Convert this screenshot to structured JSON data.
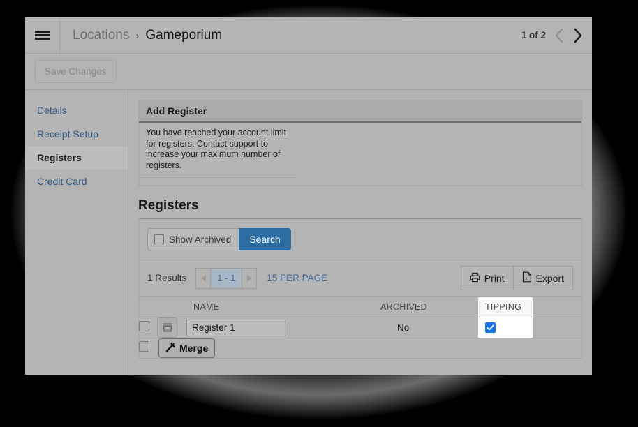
{
  "header": {
    "menu_icon": "hamburger-icon",
    "breadcrumb_parent": "Locations",
    "breadcrumb_separator": "›",
    "breadcrumb_current": "Gameporium",
    "pager_label": "1 of 2",
    "prev_icon": "chevron-left-icon",
    "next_icon": "chevron-right-icon"
  },
  "toolbar": {
    "save_label": "Save Changes"
  },
  "sidebar": {
    "items": [
      {
        "label": "Details",
        "active": false
      },
      {
        "label": "Receipt Setup",
        "active": false
      },
      {
        "label": "Registers",
        "active": true
      },
      {
        "label": "Credit Card",
        "active": false
      }
    ]
  },
  "add_register": {
    "title": "Add Register",
    "message": "You have reached your account limit for registers. Contact support to increase your maximum number of registers."
  },
  "registers": {
    "section_title": "Registers",
    "search": {
      "show_archived_label": "Show Archived",
      "show_archived_checked": false,
      "search_button": "Search"
    },
    "results": {
      "count_label": "1 Results",
      "prev_icon": "triangle-left-icon",
      "page_label": "1 - 1",
      "next_icon": "triangle-right-icon",
      "per_page_label": "15 PER PAGE",
      "print_label": "Print",
      "print_icon": "printer-icon",
      "export_label": "Export",
      "export_icon": "excel-file-icon"
    },
    "table": {
      "columns": [
        "",
        "",
        "NAME",
        "ARCHIVED",
        "TIPPING",
        ""
      ],
      "rows": [
        {
          "selected": false,
          "archive_icon": "archive-box-icon",
          "name_value": "Register 1",
          "archived": "No",
          "tipping_checked": true
        }
      ],
      "footer": {
        "selected": false,
        "merge_label": "Merge",
        "merge_icon": "magic-wand-icon"
      }
    }
  },
  "colors": {
    "window_bg": "#b4b4b4",
    "link": "#2f577f",
    "primary_button": "#2b6ca3",
    "checkbox_checked": "#1a73e8",
    "highlight_cell": "#ffffff"
  }
}
